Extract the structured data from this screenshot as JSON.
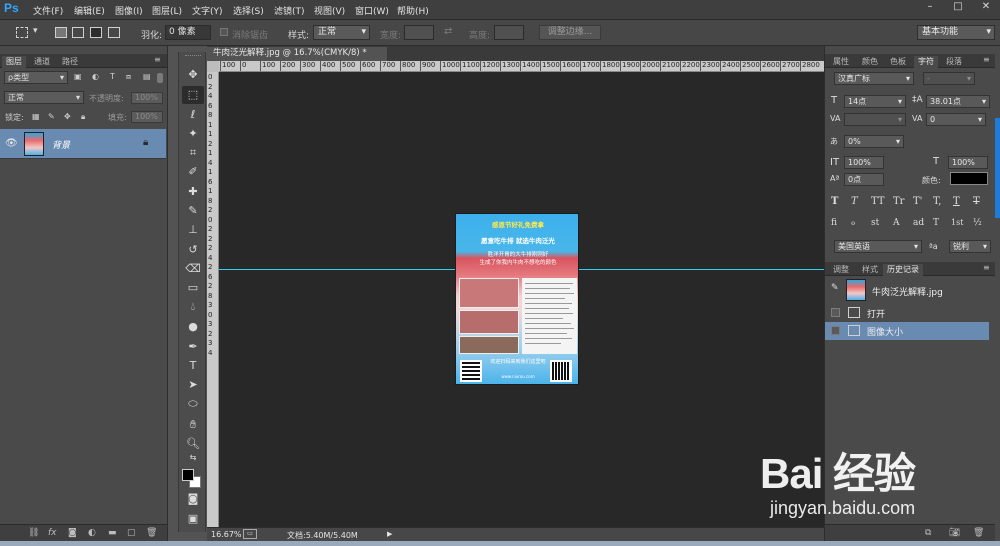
{
  "app": {
    "logo": "Ps"
  },
  "menu": [
    "文件(F)",
    "编辑(E)",
    "图像(I)",
    "图层(L)",
    "文字(Y)",
    "选择(S)",
    "滤镜(T)",
    "视图(V)",
    "窗口(W)",
    "帮助(H)"
  ],
  "window_controls": {
    "minimize": "–",
    "restore": "□",
    "close": "✕"
  },
  "options": {
    "feather_label": "羽化:",
    "feather_value": "0 像素",
    "antialias_label": "消除锯齿",
    "style_label": "样式:",
    "style_value": "正常",
    "width_label": "宽度:",
    "height_label": "高度:",
    "refine_edge": "调整边缘...",
    "workspace": "基本功能"
  },
  "layers_panel": {
    "tabs": [
      "图层",
      "通道",
      "路径"
    ],
    "filter_kind": "ρ类型",
    "blend_mode": "正常",
    "opacity_label": "不透明度:",
    "opacity_value": "100%",
    "lock_label": "锁定:",
    "fill_label": "填充:",
    "fill_value": "100%",
    "layer_name": "背景",
    "bottom_icons": [
      "link-icon",
      "fx-icon",
      "mask-icon",
      "adjustment-icon",
      "group-icon",
      "new-layer-icon",
      "trash-icon"
    ]
  },
  "document": {
    "tab_title": "牛肉泛光解释.jpg @ 16.7%(CMYK/8) *",
    "ruler_top": [
      "100",
      "0",
      "100",
      "200",
      "300",
      "400",
      "500",
      "600",
      "700",
      "800",
      "900",
      "1000",
      "1100",
      "1200",
      "1300",
      "1400",
      "1500",
      "1600",
      "1700",
      "1800",
      "1900",
      "2000",
      "2100",
      "2200",
      "2300",
      "2400",
      "2500",
      "2600",
      "2700",
      "2800"
    ],
    "ruler_left": [
      "0",
      "2",
      "4",
      "6",
      "8",
      "1",
      "1",
      "2",
      "1",
      "4",
      "1",
      "6",
      "1",
      "8",
      "2",
      "0",
      "2",
      "2",
      "2",
      "4",
      "2",
      "6",
      "2",
      "8",
      "3",
      "0",
      "3",
      "2",
      "3",
      "4"
    ],
    "zoom": "16.67%",
    "doc_size": "文档:5.40M/5.40M"
  },
  "poster": {
    "title_line1": "感恩节好礼免费拿",
    "title_line2": "愿意吃牛排 就选牛肉泛光",
    "sub_line1": "胜洋开胃的大牛排刚刚好",
    "sub_line2": "生成了你我内牛肉不想吃的颜色",
    "footer": "欢迎扫码来到我们这里吧",
    "footer_small": "www.niurou.com"
  },
  "character_panel": {
    "tabs": [
      "属性",
      "颜色",
      "色板",
      "字符",
      "段落"
    ],
    "font_family": "汉真广标",
    "font_style": "-",
    "font_size": "14点",
    "leading": "38.01点",
    "tracking": "0",
    "kerning": "",
    "scale_pct": "0%",
    "vertical_scale": "100%",
    "horizontal_scale": "100%",
    "baseline_shift": "0点",
    "color_label": "颜色:",
    "text_color": "#000000",
    "style_buttons": [
      "T",
      "T",
      "TT",
      "Tr",
      "T'",
      "T,",
      "T",
      "T"
    ],
    "opentype_buttons": [
      "fi",
      "ℴ",
      "st",
      "A",
      "ad",
      "T",
      "1st",
      "½"
    ],
    "language": "美国英语",
    "aa_label": "ªa",
    "aa_value": "锐利"
  },
  "history_panel": {
    "tabs": [
      "调整",
      "样式",
      "历史记录"
    ],
    "snapshot_name": "牛肉泛光解释.jpg",
    "steps": [
      "打开",
      "图像大小"
    ]
  },
  "watermark": {
    "logo": "Bai 经验",
    "url": "jingyan.baidu.com"
  },
  "colors": {
    "accent": "#31a8ff",
    "selection": "#6a8bb1",
    "guide": "#2fd0f0",
    "canvas_bg": "#282828"
  }
}
